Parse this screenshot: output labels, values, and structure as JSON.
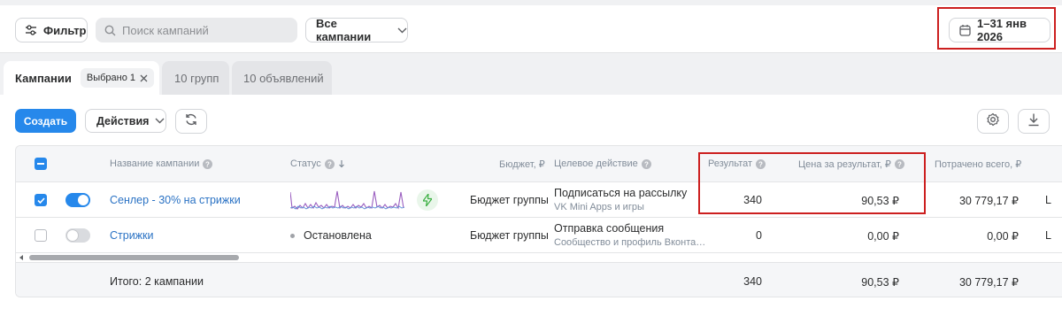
{
  "toolbar": {
    "filter_label": "Фильтр",
    "search_placeholder": "Поиск кампаний",
    "all_campaigns_label": "Все кампании",
    "date_range": "1–31 янв 2026"
  },
  "tabs": {
    "campaigns_label": "Кампании",
    "selected_chip": "Выбрано 1",
    "groups_label": "10 групп",
    "ads_label": "10 объявлений"
  },
  "actions": {
    "create_label": "Создать",
    "actions_label": "Действия"
  },
  "table": {
    "headers": {
      "name": "Название кампании",
      "status": "Статус",
      "budget": "Бюджет, ₽",
      "goal": "Целевое действие",
      "result": "Результат",
      "cost_per_result": "Цена за результат, ₽",
      "spent": "Потрачено всего, ₽"
    },
    "rows": [
      {
        "checked": true,
        "enabled": true,
        "name": "Сенлер - 30% на стрижки",
        "budget": "Бюджет группы",
        "goal": "Подписаться на рассылку",
        "goal_sub": "VK Mini Apps и игры",
        "result": "340",
        "cost_per_result": "90,53 ₽",
        "spent": "30 779,17 ₽",
        "overflow": "L"
      },
      {
        "checked": false,
        "enabled": false,
        "name": "Стрижки",
        "status": "Остановлена",
        "budget": "Бюджет группы",
        "goal": "Отправка сообщения",
        "goal_sub": "Сообщество и профиль Вконта…",
        "result": "0",
        "cost_per_result": "0,00 ₽",
        "spent": "0,00 ₽",
        "overflow": "L"
      }
    ],
    "totals": {
      "label": "Итого: 2 кампании",
      "result": "340",
      "cost_per_result": "90,53 ₽",
      "spent": "30 779,17 ₽"
    }
  },
  "colors": {
    "accent": "#2688eb",
    "link": "#2a72c4",
    "highlight": "#cc1f1f",
    "sparkline": "#9b5fc0"
  }
}
